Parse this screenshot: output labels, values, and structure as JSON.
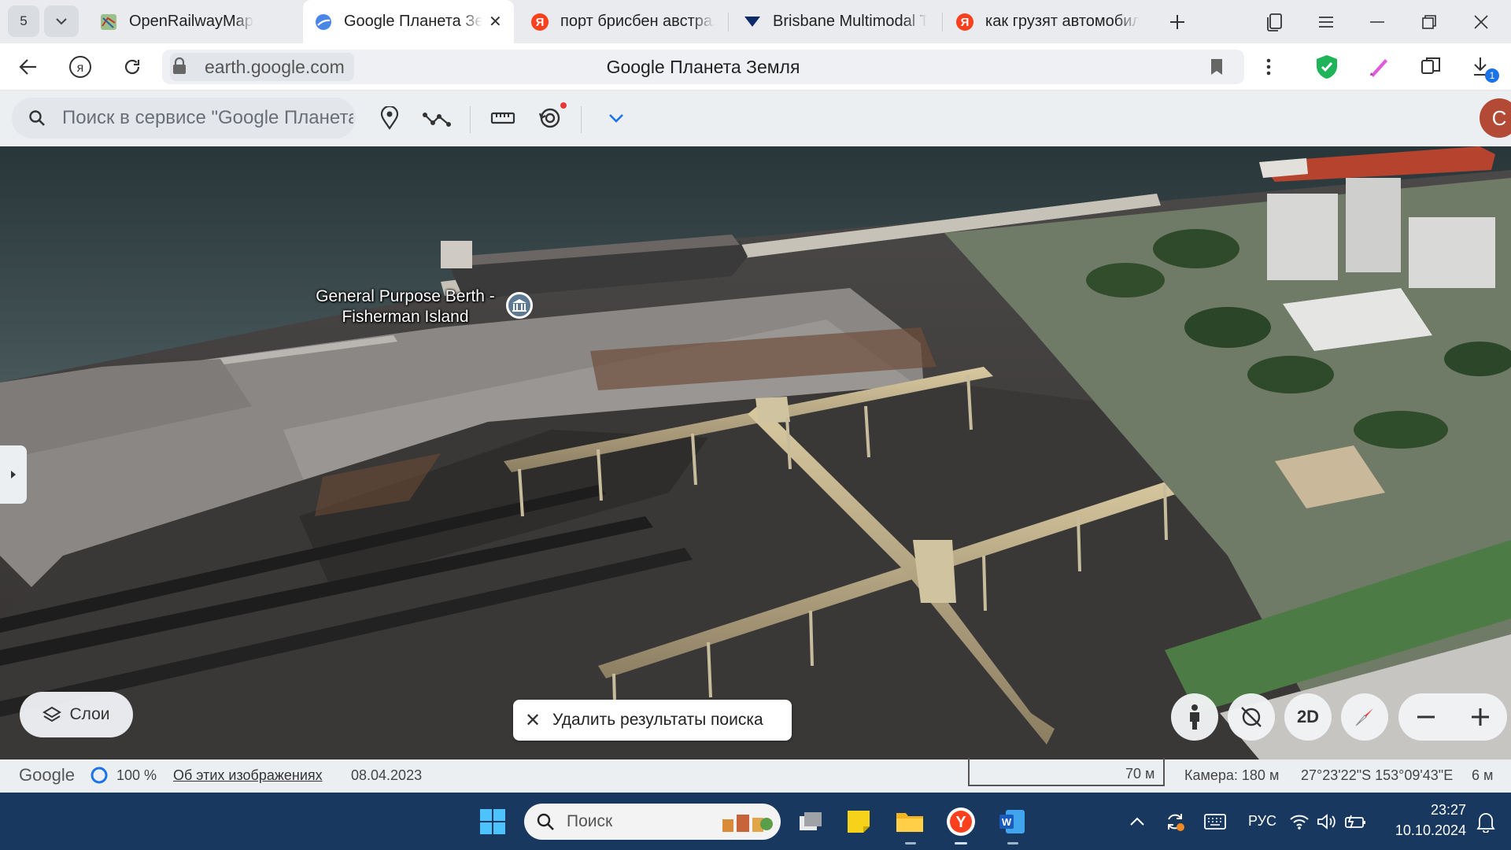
{
  "browser": {
    "tab_count": "5",
    "tabs": [
      {
        "label": "OpenRailwayMap",
        "icon": "openrailwaymap-favicon"
      },
      {
        "label": "Google Планета Земля",
        "icon": "google-earth-favicon",
        "active": true
      },
      {
        "label": "порт брисбен австралия",
        "icon": "yandex-favicon"
      },
      {
        "label": "Brisbane Multimodal Terminal",
        "icon": "triangle-favicon"
      },
      {
        "label": "как грузят автомобили",
        "icon": "yandex-favicon"
      }
    ],
    "url": "earth.google.com",
    "page_title": "Google Планета Земля",
    "downloads_badge": "1"
  },
  "earth": {
    "search_placeholder": "Поиск в сервисе \"Google Планета Земля\"",
    "avatar_letter": "C",
    "poi_label": "General Purpose Berth - Fisherman Island",
    "layers_label": "Слои",
    "clear_search_label": "Удалить результаты поиска",
    "mode_2d_label": "2D",
    "status": {
      "brand": "Google",
      "opacity": "100 %",
      "about_link": "Об этих изображениях",
      "imagery_date": "08.04.2023",
      "scale_label": "70 м",
      "camera": "Камера: 180 м",
      "coordinates": "27°23'22\"S 153°09'43\"E",
      "elevation": "6 м"
    }
  },
  "taskbar": {
    "search_label": "Поиск",
    "language": "РУС",
    "time": "23:27",
    "date": "10.10.2024"
  },
  "colors": {
    "taskbar": "#18385f",
    "avatar": "#b24a36",
    "yandex_red": "#fc3f1d"
  }
}
